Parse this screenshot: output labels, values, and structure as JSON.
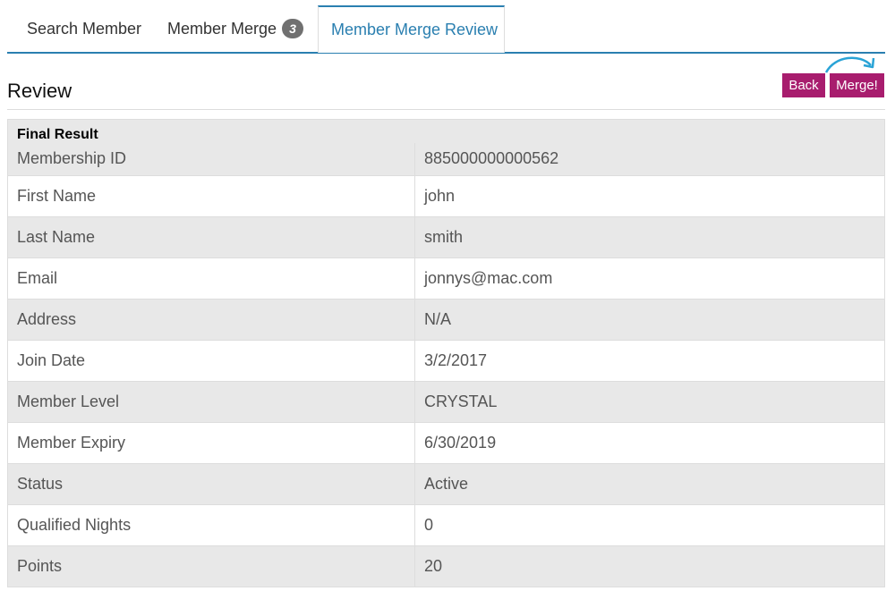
{
  "tabs": [
    {
      "label": "Search Member"
    },
    {
      "label": "Member Merge",
      "badge": "3"
    },
    {
      "label": "Member Merge Review"
    }
  ],
  "header": {
    "title": "Review",
    "back_label": "Back",
    "merge_label": "Merge!"
  },
  "colors": {
    "accent": "#2a7fb0",
    "button": "#a81d6e",
    "arrow": "#29a3d6"
  },
  "table": {
    "caption": "Final Result",
    "rows": [
      {
        "label": "Membership ID",
        "value": "885000000000562"
      },
      {
        "label": "First Name",
        "value": "john"
      },
      {
        "label": "Last Name",
        "value": "smith"
      },
      {
        "label": "Email",
        "value": "jonnys@mac.com"
      },
      {
        "label": "Address",
        "value": "N/A"
      },
      {
        "label": "Join Date",
        "value": "3/2/2017"
      },
      {
        "label": "Member Level",
        "value": "CRYSTAL"
      },
      {
        "label": "Member Expiry",
        "value": "6/30/2019"
      },
      {
        "label": "Status",
        "value": "Active"
      },
      {
        "label": "Qualified Nights",
        "value": "0"
      },
      {
        "label": "Points",
        "value": "20"
      }
    ]
  }
}
